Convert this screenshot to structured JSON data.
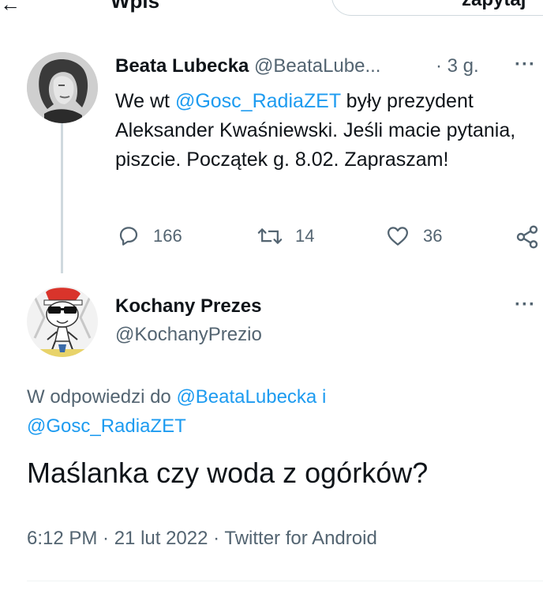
{
  "top": {
    "title_partial": "Wpis",
    "pill_partial": "zapytaj"
  },
  "parent_tweet": {
    "author_name": "Beata Lubecka",
    "handle": "@BeataLube...",
    "time": "· 3 g.",
    "text_before": "We wt ",
    "mention": "@Gosc_RadiaZET",
    "text_after": " były prezydent Aleksander Kwaśniewski. Jeśli macie pytania, piszcie. Początek g. 8.02. Zapraszam!",
    "replies": "166",
    "retweets": "14",
    "likes": "36"
  },
  "main_tweet": {
    "author_name": "Kochany Prezes",
    "handle": "@KochanyPrezio",
    "reply_prefix": "W odpowiedzi do",
    "reply_user1": "@BeataLubecka",
    "reply_and": "i",
    "reply_user2": "@Gosc_RadiaZET",
    "text": "Maślanka czy woda z ogórków?",
    "meta": "6:12 PM · 21 lut 2022 · Twitter for Android"
  },
  "icons": {
    "more": "more-icon",
    "reply": "reply-icon",
    "retweet": "retweet-icon",
    "like": "like-icon",
    "share": "share-icon"
  },
  "colors": {
    "accent": "#1d9bf0",
    "secondary": "#536471",
    "text": "#0f1419",
    "divider": "#cfd9de"
  }
}
